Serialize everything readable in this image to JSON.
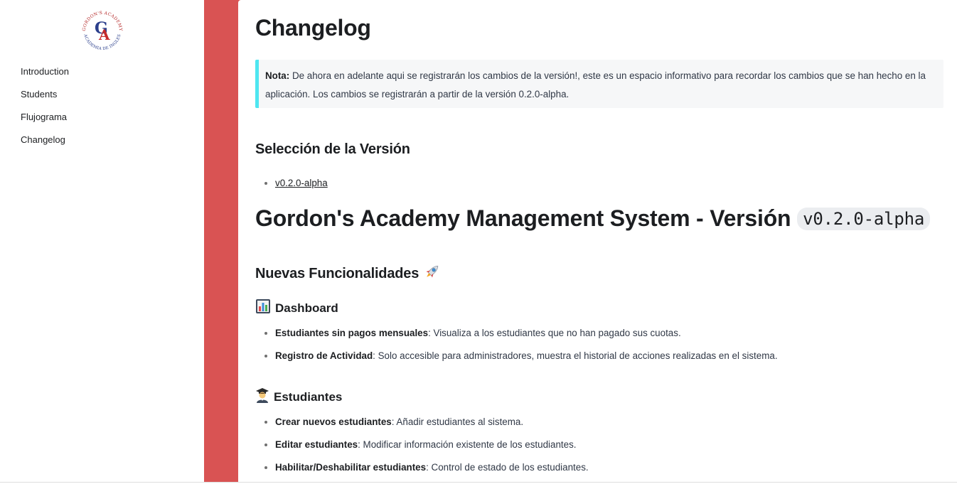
{
  "sidebar": {
    "logo": {
      "top_text": "GORDON'S ACADEMY",
      "bottom_text": "ACADEMIA DE INGLES",
      "letters": "GA"
    },
    "items": [
      {
        "label": "Introduction"
      },
      {
        "label": "Students"
      },
      {
        "label": "Flujograma"
      },
      {
        "label": "Changelog"
      }
    ]
  },
  "colors": {
    "accent_band": "#d95353",
    "note_border": "#4ee6f0",
    "note_bg": "#f6f7f8"
  },
  "main": {
    "title": "Changelog",
    "note": {
      "label": "Nota:",
      "text": "De ahora en adelante aqui se registrarán los cambios de la versión!, este es un espacio informativo para recordar los cambios que se han hecho en la aplicación. Los cambios se registrarán a partir de la versión 0.2.0-alpha."
    },
    "version_heading": "Selección de la Versión",
    "versions": [
      {
        "label": "v0.2.0-alpha"
      }
    ],
    "release_title": "Gordon's Academy Management System - Versión",
    "release_code": "v0.2.0-alpha",
    "new_features_heading": "Nuevas Funcionalidades",
    "sections": {
      "dashboard": {
        "icon": "bar-chart-icon",
        "heading": "Dashboard",
        "items": [
          {
            "term": "Estudiantes sin pagos mensuales",
            "desc": ": Visualiza a los estudiantes que no han pagado sus cuotas."
          },
          {
            "term": "Registro de Actividad",
            "desc": ": Solo accesible para administradores, muestra el historial de acciones realizadas en el sistema."
          }
        ]
      },
      "students": {
        "icon": "student-icon",
        "heading": "Estudiantes",
        "items": [
          {
            "term": "Crear nuevos estudiantes",
            "desc": ": Añadir estudiantes al sistema."
          },
          {
            "term": "Editar estudiantes",
            "desc": ": Modificar información existente de los estudiantes."
          },
          {
            "term": "Habilitar/Deshabilitar estudiantes",
            "desc": ": Control de estado de los estudiantes."
          }
        ]
      }
    }
  }
}
